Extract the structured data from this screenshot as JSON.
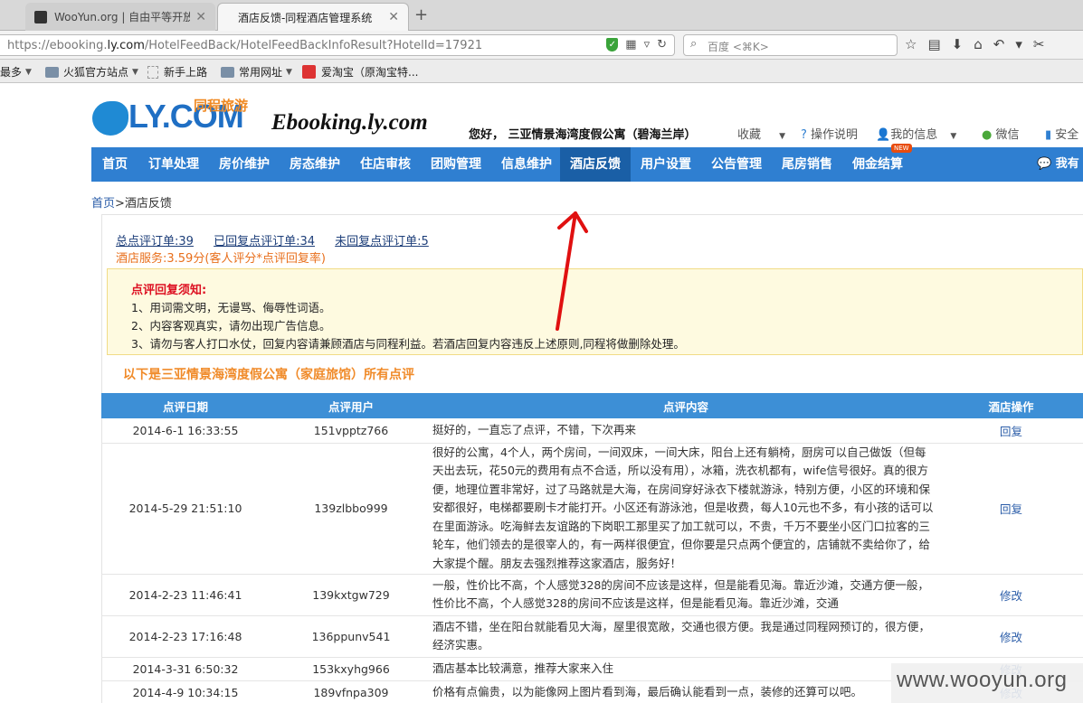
{
  "browser": {
    "tabs": [
      {
        "title": "WooYun.org | 自由平等开放..."
      },
      {
        "title": "酒店反馈-同程酒店管理系统"
      }
    ],
    "url": {
      "prefix": "https://ebooking.",
      "domain": "ly.com",
      "path": "/HotelFeedBack/HotelFeedBackInfoResult?HotelId=17921"
    },
    "search_placeholder": "百度 <⌘K>",
    "bookmarks": [
      "最多",
      "火狐官方站点",
      "新手上路",
      "常用网址",
      "爱淘宝（原淘宝特..."
    ]
  },
  "header": {
    "logo_text": "LY.COM",
    "logo_cn": "同程旅游",
    "ebooking": "Ebooking.ly.com",
    "greeting": "您好， 三亚情景海湾度假公寓（碧海兰岸）",
    "menu": [
      "收藏",
      "操作说明",
      "我的信息",
      "微信",
      "安全"
    ]
  },
  "nav": {
    "items": [
      "首页",
      "订单处理",
      "房价维护",
      "房态维护",
      "住店审核",
      "团购管理",
      "信息维护",
      "酒店反馈",
      "用户设置",
      "公告管理",
      "尾房销售",
      "佣金结算"
    ],
    "active": "酒店反馈",
    "badge": "NEW",
    "right": "我有"
  },
  "breadcrumb": {
    "home": "首页",
    "sep": ">",
    "current": "酒店反馈"
  },
  "stats": {
    "total": "总点评订单:39",
    "replied": "已回复点评订单:34",
    "unreplied": "未回复点评订单:5",
    "service": "酒店服务:3.59分(客人评分*点评回复率)"
  },
  "notice": {
    "title": "点评回复须知:",
    "lines": [
      "1、用词需文明，无谩骂、侮辱性词语。",
      "2、内容客观真实，请勿出现广告信息。",
      "3、请勿与客人打口水仗，回复内容请兼顾酒店与同程利益。若酒店回复内容违反上述原则,同程将做删除处理。"
    ]
  },
  "section_title": "以下是三亚情景海湾度假公寓（家庭旅馆）所有点评",
  "table": {
    "headers": [
      "点评日期",
      "点评用户",
      "点评内容",
      "酒店操作"
    ],
    "rows": [
      {
        "date": "2014-6-1 16:33:55",
        "user": "151vpptz766",
        "text": "挺好的，一直忘了点评，不错，下次再来",
        "op": "回复"
      },
      {
        "date": "2014-5-29 21:51:10",
        "user": "139zlbbo999",
        "text": "很好的公寓，4个人，两个房间，一间双床，一间大床，阳台上还有躺椅，厨房可以自己做饭（但每天出去玩，花50元的费用有点不合适，所以没有用），冰箱，洗衣机都有，wife信号很好。真的很方便，地理位置非常好，过了马路就是大海，在房间穿好泳衣下楼就游泳，特别方便，小区的环境和保安都很好，电梯都要刷卡才能打开。小区还有游泳池，但是收费，每人10元也不多，有小孩的话可以在里面游泳。吃海鲜去友谊路的下岗职工那里买了加工就可以，不贵，千万不要坐小区门口拉客的三轮车，他们领去的是很宰人的，有一两样很便宜，但你要是只点两个便宜的，店铺就不卖给你了，给大家提个醒。朋友去强烈推荐这家酒店，服务好！",
        "op": "回复"
      },
      {
        "date": "2014-2-23 11:46:41",
        "user": "139kxtgw729",
        "text": "一般，性价比不高，个人感觉328的房间不应该是这样，但是能看见海。靠近沙滩，交通方便一般，性价比不高，个人感觉328的房间不应该是这样，但是能看见海。靠近沙滩，交通",
        "op": "修改"
      },
      {
        "date": "2014-2-23 17:16:48",
        "user": "136ppunv541",
        "text": "酒店不错，坐在阳台就能看见大海，屋里很宽敞，交通也很方便。我是通过同程网预订的，很方便，经济实惠。",
        "op": "修改"
      },
      {
        "date": "2014-3-31 6:50:32",
        "user": "153kxyhg966",
        "text": "酒店基本比较满意，推荐大家来入住",
        "op": "修改"
      },
      {
        "date": "2014-4-9 10:34:15",
        "user": "189vfnpa309",
        "text": "价格有点偏贵，以为能像网上图片看到海，最后确认能看到一点，装修的还算可以吧。",
        "op": "修改"
      }
    ]
  },
  "watermark": "www.wooyun.org"
}
